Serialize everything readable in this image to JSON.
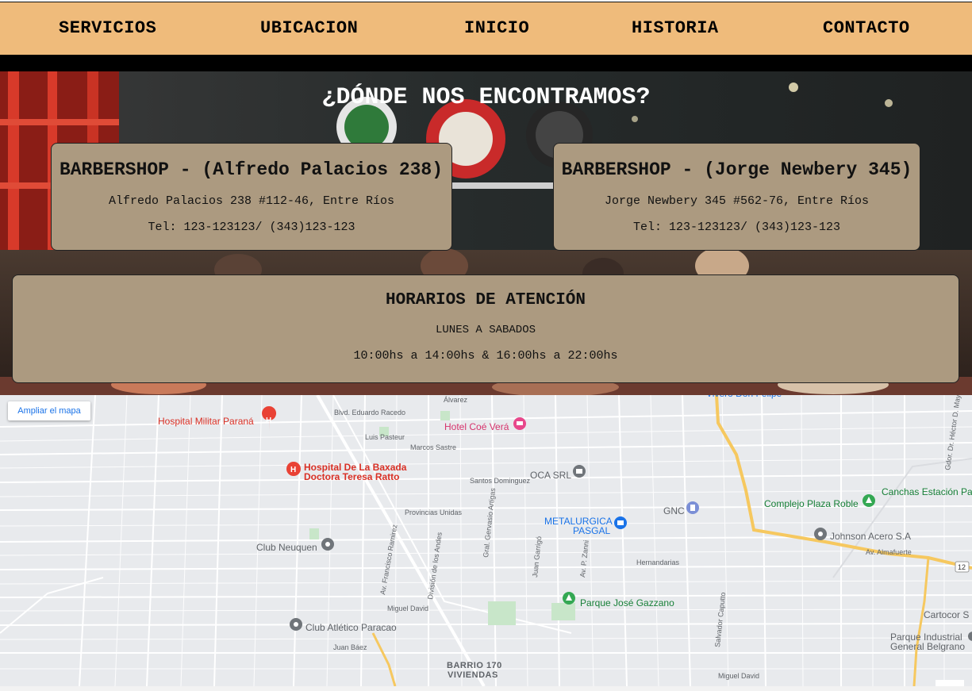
{
  "nav": {
    "items": [
      "SERVICIOS",
      "UBICACION",
      "INICIO",
      "HISTORIA",
      "CONTACTO"
    ]
  },
  "hero": {
    "title": "¿DÓNDE NOS ENCONTRAMOS?"
  },
  "locations": [
    {
      "title": "BARBERSHOP - (Alfredo Palacios 238)",
      "address": "Alfredo Palacios 238 #112-46, Entre Ríos",
      "phone": "Tel: 123-123123/ (343)123-123"
    },
    {
      "title": "BARBERSHOP - (Jorge Newbery 345)",
      "address": "Jorge Newbery 345 #562-76, Entre Ríos",
      "phone": "Tel: 123-123123/ (343)123-123"
    }
  ],
  "hours": {
    "title": "HORARIOS DE ATENCIÓN",
    "days": "LUNES A SABADOS",
    "times": "10:00hs a 14:00hs & 16:00hs a 22:00hs"
  },
  "map": {
    "enlarge_label": "Ampliar el mapa",
    "places": [
      {
        "name": "Hospital Militar Paraná",
        "icon": "hospital-pin-icon"
      },
      {
        "name": "Hotel Coé Verá",
        "icon": "hotel-pin-icon"
      },
      {
        "name": "Hospital De La Baxada",
        "icon": "hospital-pin-icon"
      },
      {
        "name": "Doctora Teresa Ratto",
        "icon": ""
      },
      {
        "name": "OCA SRL",
        "icon": "mail-pin-icon"
      },
      {
        "name": "Complejo Plaza Roble",
        "icon": "park-pin-icon"
      },
      {
        "name": "Canchas Estación Pa",
        "icon": ""
      },
      {
        "name": "GNC",
        "icon": "fuel-pin-icon"
      },
      {
        "name": "METALURGICA",
        "icon": "shop-pin-icon"
      },
      {
        "name": "PASGAL",
        "icon": ""
      },
      {
        "name": "Johnson Acero S.A",
        "icon": "place-pin-icon"
      },
      {
        "name": "Club Neuquen",
        "icon": "place-pin-icon"
      },
      {
        "name": "Parque José Gazzano",
        "icon": "park-pin-icon"
      },
      {
        "name": "Club Atlético Paracao",
        "icon": "place-pin-icon"
      },
      {
        "name": "Cartocor S",
        "icon": ""
      },
      {
        "name": "Parque Industrial",
        "icon": ""
      },
      {
        "name": "General Belgrano",
        "icon": ""
      },
      {
        "name": "BARRIO 170",
        "icon": ""
      },
      {
        "name": "VIVIENDAS",
        "icon": ""
      }
    ],
    "streets": [
      "Blvd. Eduardo Racedo",
      "Luis Pasteur",
      "Marcos Sastre",
      "Santos Dominguez",
      "Provincias Unidas",
      "Av. Almafuerte",
      "Hernandarias",
      "Miguel David",
      "Juan Báez",
      "Av. Francisco Ramirez",
      "División de los Andes",
      "Gral. Gervasio Artigas",
      "Juan Garrigó",
      "Av. P. Zanni",
      "Salvador Caputto",
      "Gdor. Dr. Héctor D. Maya",
      "Álvarez",
      "12"
    ],
    "colors": {
      "road": "#ffffff",
      "highway": "#f6c85f",
      "park": "#c8e6c9",
      "pin_red": "#e94235",
      "pin_gray": "#70757a",
      "pin_green": "#34a853",
      "pin_blue": "#1a73e8",
      "pin_pink": "#e8478b"
    }
  }
}
